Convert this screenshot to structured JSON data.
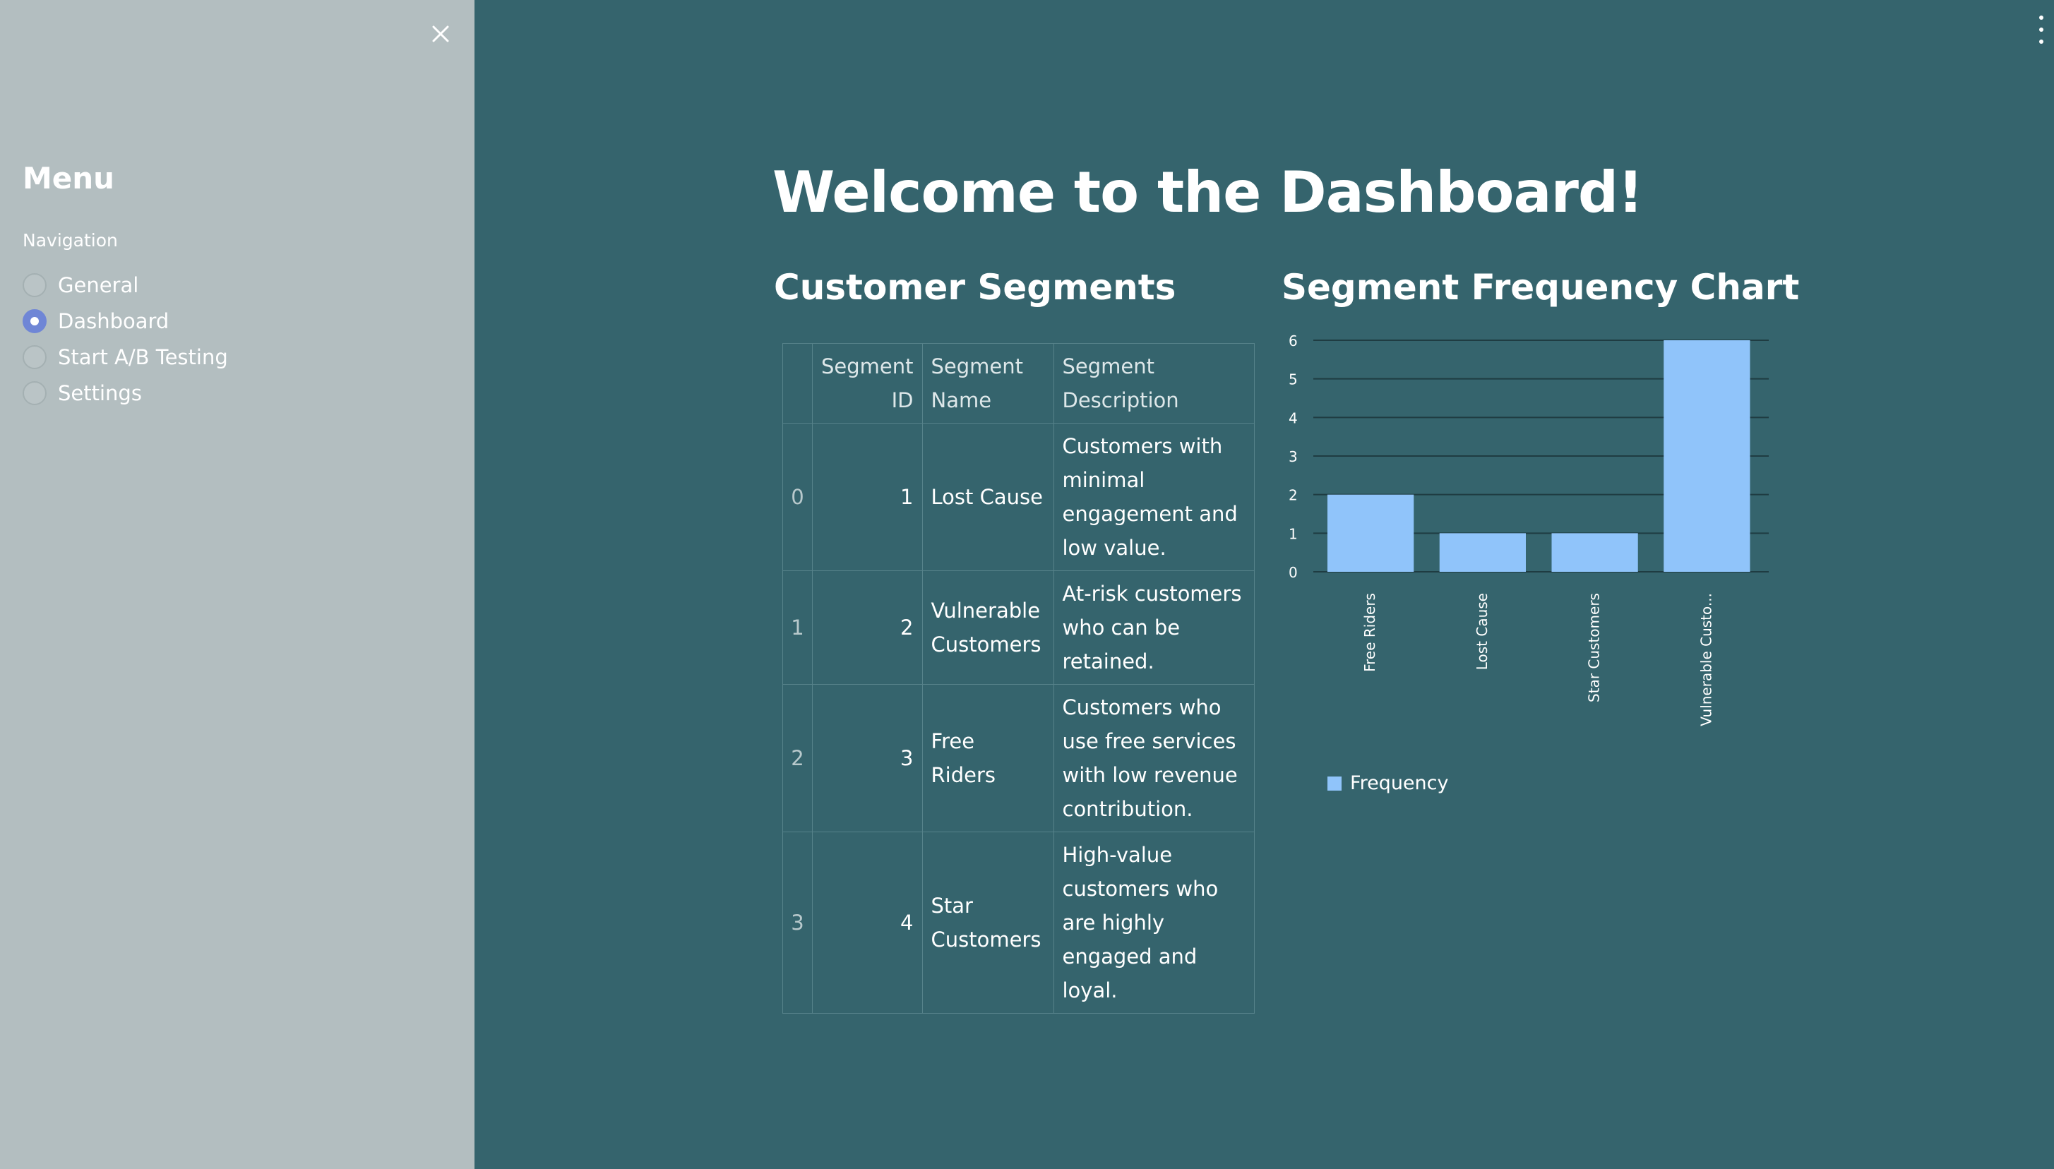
{
  "sidebar": {
    "title": "Menu",
    "nav_label": "Navigation",
    "items": [
      {
        "label": "General",
        "selected": false
      },
      {
        "label": "Dashboard",
        "selected": true
      },
      {
        "label": "Start A/B Testing",
        "selected": false
      },
      {
        "label": "Settings",
        "selected": false
      }
    ]
  },
  "main": {
    "title": "Welcome to the Dashboard!",
    "segments_title": "Customer Segments",
    "chart_title": "Segment Frequency Chart"
  },
  "table": {
    "headers": [
      "",
      "Segment ID",
      "Segment Name",
      "Segment Description"
    ],
    "rows": [
      {
        "index": "0",
        "id": "1",
        "name": "Lost Cause",
        "description": "Customers with minimal engagement and low value."
      },
      {
        "index": "1",
        "id": "2",
        "name": "Vulnerable Customers",
        "description": "At-risk customers who can be retained."
      },
      {
        "index": "2",
        "id": "3",
        "name": "Free Riders",
        "description": "Customers who use free services with low revenue contribution."
      },
      {
        "index": "3",
        "id": "4",
        "name": "Star Customers",
        "description": "High-value customers who are highly engaged and loyal."
      }
    ]
  },
  "colors": {
    "background": "#35646d",
    "sidebar": "#b3bec0",
    "bar": "#90c4fa",
    "radio_selected": "#6f86d6"
  },
  "icons": {
    "close": "close-icon",
    "menu": "kebab-menu-icon"
  },
  "chart_data": {
    "type": "bar",
    "categories": [
      "Free Riders",
      "Lost Cause",
      "Star Customers",
      "Vulnerable Custo..."
    ],
    "series": [
      {
        "name": "Frequency",
        "values": [
          2,
          1,
          1,
          6
        ]
      }
    ],
    "ylim": [
      0,
      6
    ],
    "yticks": [
      "0",
      "1",
      "2",
      "3",
      "4",
      "5",
      "6"
    ],
    "legend": "bottom-left",
    "grid": true
  }
}
